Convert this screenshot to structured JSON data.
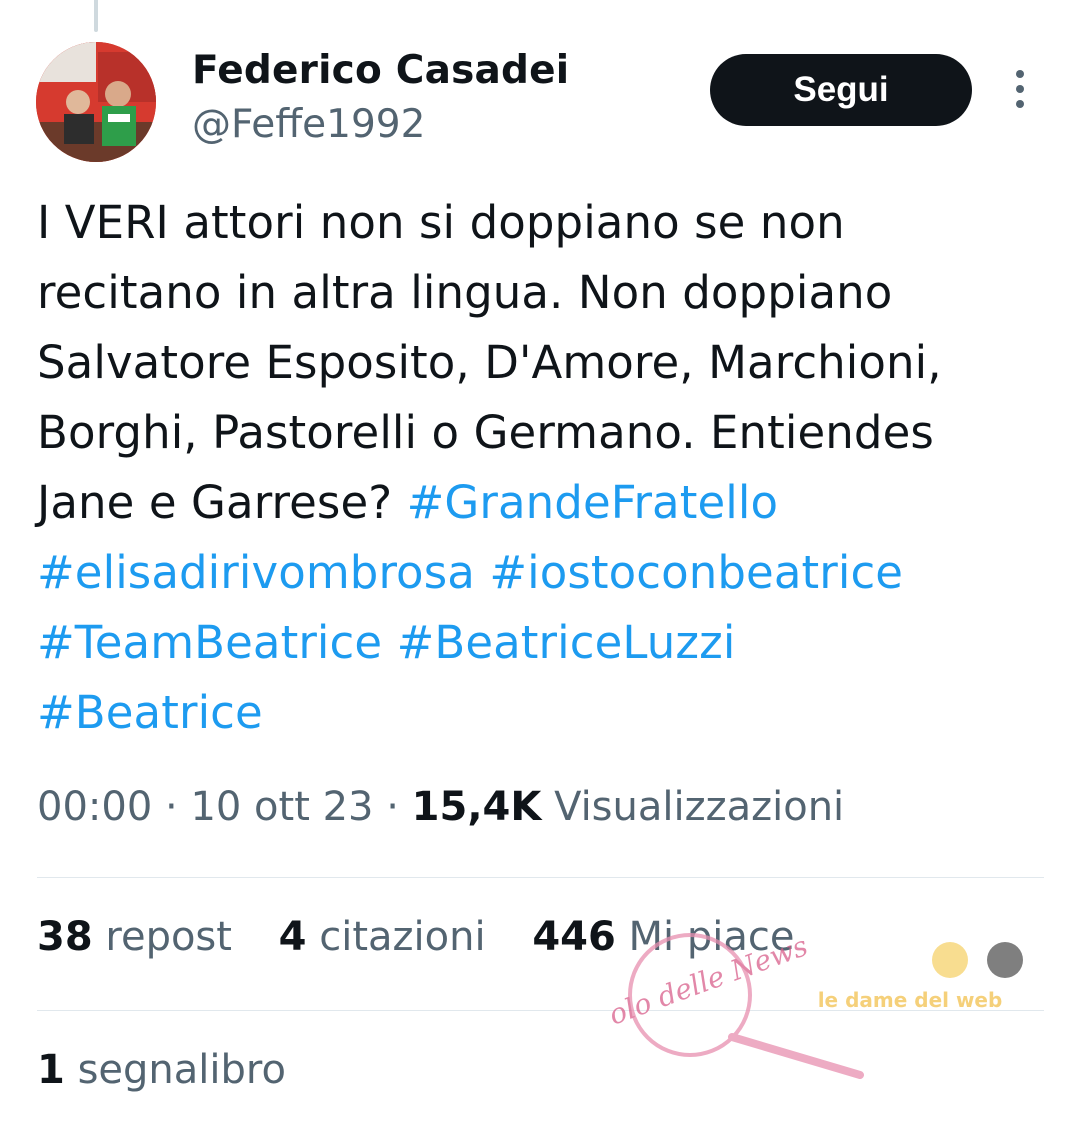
{
  "author": {
    "name": "Federico Casadei",
    "handle": "@Feffe1992"
  },
  "follow_label": "Segui",
  "tweet": {
    "lines": [
      [
        "I VERI attori non si doppiano se non"
      ],
      [
        "recitano in altra lingua. Non doppiano"
      ],
      [
        "Salvatore Esposito, D'Amore, Marchioni,"
      ],
      [
        "Borghi, Pastorelli o Germano. Entiendes"
      ],
      [
        "Jane e Garrese? ",
        "#GrandeFratello"
      ],
      [
        "#elisadirivombrosa",
        " ",
        "#iostoconbeatrice"
      ],
      [
        "#TeamBeatrice",
        " ",
        "#BeatriceLuzzi"
      ],
      [
        "#Beatrice"
      ]
    ]
  },
  "meta": {
    "time": "00:00",
    "date": "10 ott 23",
    "views_count": "15,4K",
    "views_label": "Visualizzazioni"
  },
  "stats": {
    "reposts_count": "38",
    "reposts_label": "repost",
    "quotes_count": "4",
    "quotes_label": "citazioni",
    "likes_count": "446",
    "likes_label": "Mi piace",
    "bookmarks_count": "1",
    "bookmarks_label": "segnalibro"
  },
  "watermark": {
    "text": "Vicolo delle News",
    "text2": "le dame del web"
  },
  "colors": {
    "hashtag": "#1d9bf0",
    "secondary_text": "#536471",
    "primary_text": "#0f1419",
    "follow_button": "#0f1419"
  }
}
